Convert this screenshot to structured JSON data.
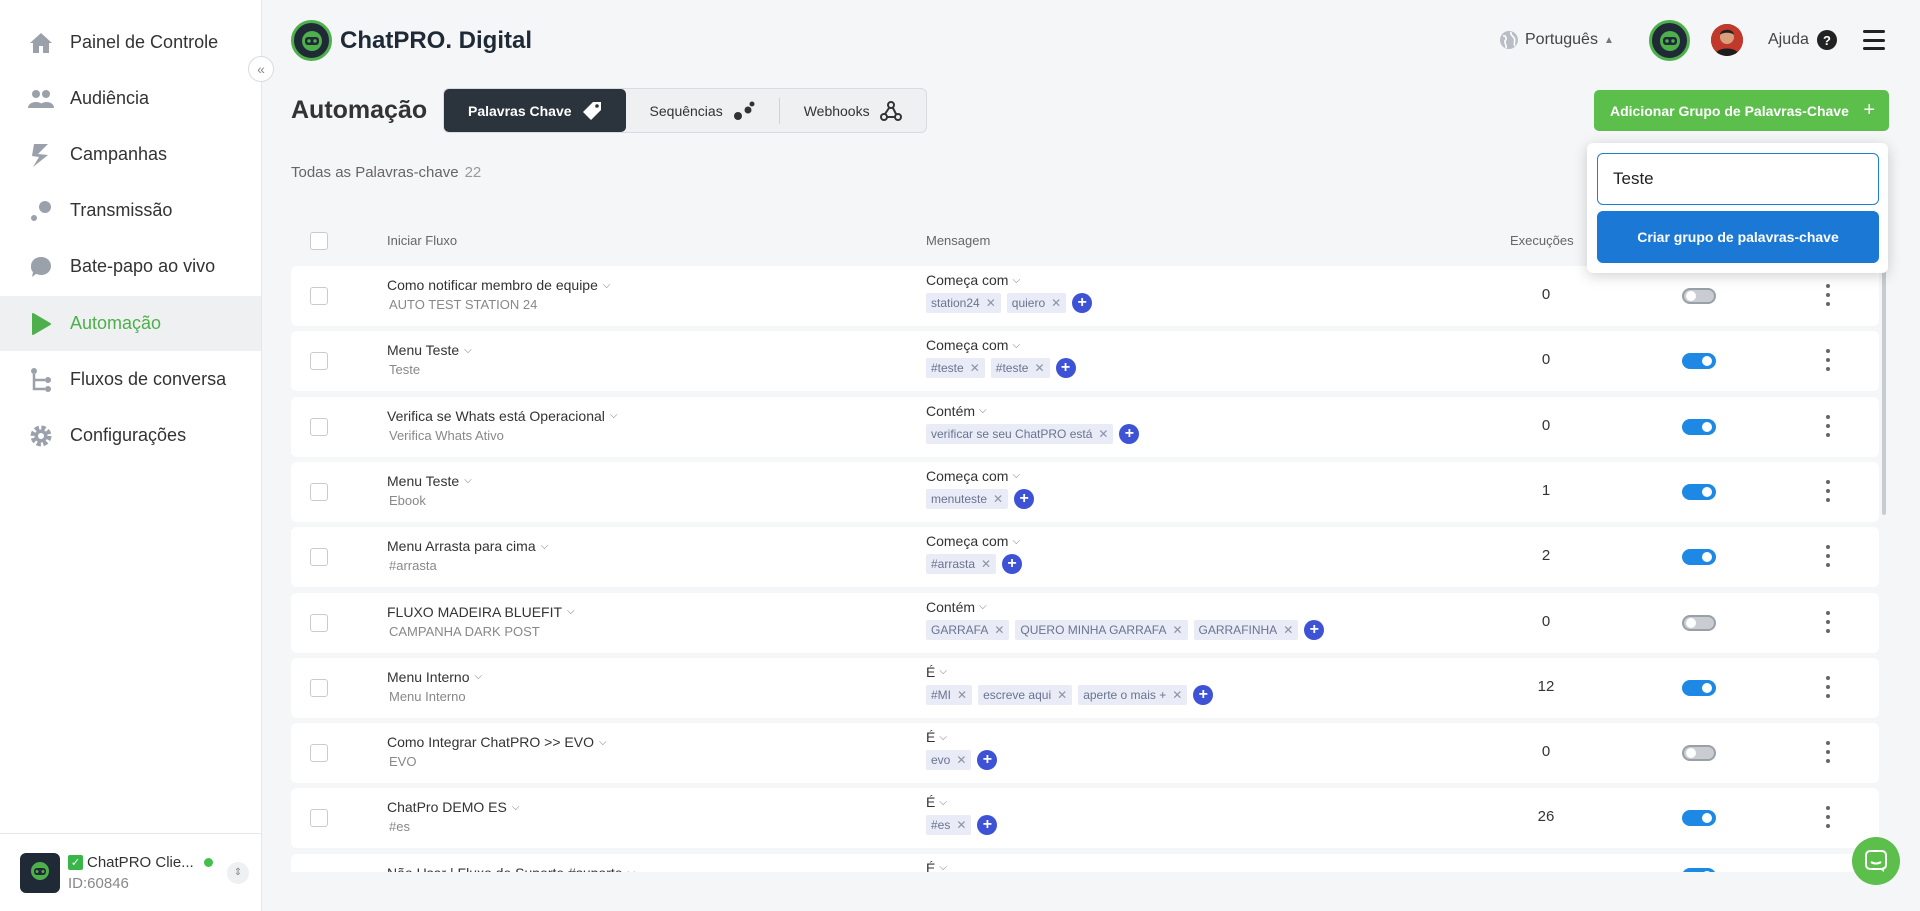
{
  "sidebar": {
    "items": [
      {
        "label": "Painel de Controle",
        "icon": "home-icon"
      },
      {
        "label": "Audiência",
        "icon": "people-icon"
      },
      {
        "label": "Campanhas",
        "icon": "campaign-icon"
      },
      {
        "label": "Transmissão",
        "icon": "broadcast-icon"
      },
      {
        "label": "Bate-papo ao vivo",
        "icon": "chat-bubble-icon"
      },
      {
        "label": "Automação",
        "icon": "play-icon",
        "active": true
      },
      {
        "label": "Fluxos de conversa",
        "icon": "flow-icon"
      },
      {
        "label": "Configurações",
        "icon": "gear-icon"
      }
    ],
    "account": {
      "name": "ChatPRO Clie...",
      "id": "ID:60846"
    }
  },
  "header": {
    "brand": "ChatPRO. Digital",
    "language": "Português",
    "help": "Ajuda"
  },
  "page": {
    "title": "Automação",
    "tabs": [
      {
        "label": "Palavras Chave",
        "active": true
      },
      {
        "label": "Sequências"
      },
      {
        "label": "Webhooks"
      }
    ],
    "add_button": "Adicionar Grupo de Palavras-Chave",
    "all_label": "Todas as Palavras-chave",
    "all_count": "22"
  },
  "popup": {
    "input_value": "Teste",
    "create_button": "Criar grupo de palavras-chave"
  },
  "table": {
    "headers": {
      "flow": "Iniciar Fluxo",
      "message": "Mensagem",
      "executions": "Execuções"
    },
    "rows": [
      {
        "title": "Como notificar membro de equipe",
        "sub": "AUTO TEST STATION 24",
        "cond": "Começa com",
        "keywords": [
          "station24",
          "quiero"
        ],
        "exec": "0",
        "on": false
      },
      {
        "title": "Menu Teste",
        "sub": "Teste",
        "cond": "Começa com",
        "keywords": [
          "#teste",
          "#teste"
        ],
        "exec": "0",
        "on": true
      },
      {
        "title": "Verifica se Whats está Operacional",
        "sub": "Verifica Whats Ativo",
        "cond": "Contém",
        "keywords": [
          "verificar se seu ChatPRO está"
        ],
        "exec": "0",
        "on": true
      },
      {
        "title": "Menu Teste",
        "sub": "Ebook",
        "cond": "Começa com",
        "keywords": [
          "menuteste"
        ],
        "exec": "1",
        "on": true
      },
      {
        "title": "Menu Arrasta para cima",
        "sub": "#arrasta",
        "cond": "Começa com",
        "keywords": [
          "#arrasta"
        ],
        "exec": "2",
        "on": true
      },
      {
        "title": "FLUXO MADEIRA BLUEFIT",
        "sub": "CAMPANHA DARK POST",
        "cond": "Contém",
        "keywords": [
          "GARRAFA",
          "QUERO MINHA GARRAFA",
          "GARRAFINHA"
        ],
        "exec": "0",
        "on": false
      },
      {
        "title": "Menu Interno",
        "sub": "Menu Interno",
        "cond": "É",
        "keywords": [
          "#MI",
          "escreve aqui",
          "aperte o mais +"
        ],
        "exec": "12",
        "on": true
      },
      {
        "title": "Como Integrar ChatPRO >> EVO",
        "sub": "EVO",
        "cond": "É",
        "keywords": [
          "evo"
        ],
        "exec": "0",
        "on": false
      },
      {
        "title": "ChatPro DEMO ES",
        "sub": "#es",
        "cond": "É",
        "keywords": [
          "#es"
        ],
        "exec": "26",
        "on": true
      },
      {
        "title": "Não Usar | Fluxo de Suporte #suporte",
        "sub": "",
        "cond": "É",
        "keywords": [],
        "exec": "",
        "on": true
      }
    ]
  },
  "colors": {
    "brand_green": "#5cbf4c",
    "primary_blue": "#1b78d4",
    "toggle_on": "#1e88e5",
    "tag_add": "#3e52d6"
  }
}
